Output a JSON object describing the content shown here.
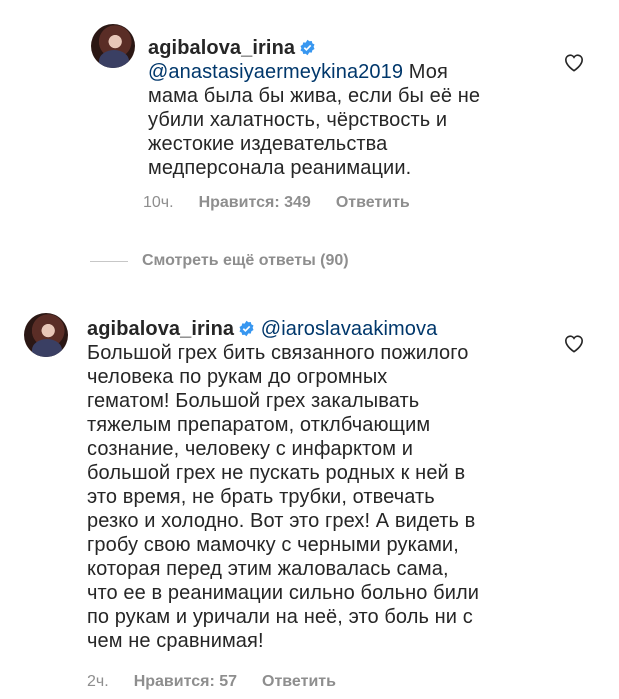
{
  "comments": [
    {
      "username": "agibalova_irina",
      "mention": "@anastasiyaermeykina2019",
      "text_first": " Моя",
      "lines": [
        "мама была бы жива, если бы её не",
        "убили халатность, чёрствость и",
        "жестокие издевательства",
        "медперсонала реанимации."
      ],
      "time": "10ч.",
      "likes": "Нравится: 349",
      "reply": "Ответить"
    },
    {
      "username": "agibalova_irina",
      "mention": "@iaroslavaakimova",
      "lines": [
        "Большой грех бить связанного пожилого",
        "человека по рукам до огромных",
        "гематом! Большой грех закалывать",
        "тяжелым препаратом, отклбчающим",
        "сознание, человеку с инфарктом и",
        "большой грех не пускать родных к ней в",
        "это время, не брать трубки, отвечать",
        "резко и холодно. Вот это грех! А видеть в",
        "гробу свою мамочку с черными руками,",
        "которая перед этим жаловалась сама,",
        "что ее в реанимации сильно больно били",
        "по рукам и уричали на неё, это боль ни с",
        "чем не сравнимая!"
      ],
      "time": "2ч.",
      "likes": "Нравится: 57",
      "reply": "Ответить"
    }
  ],
  "more_replies": "Смотреть ещё ответы (90)",
  "colors": {
    "mention": "#00376b",
    "meta": "#8e8e8e",
    "verified": "#3897f0"
  },
  "icons": [
    "verified-badge-icon",
    "heart-icon"
  ]
}
